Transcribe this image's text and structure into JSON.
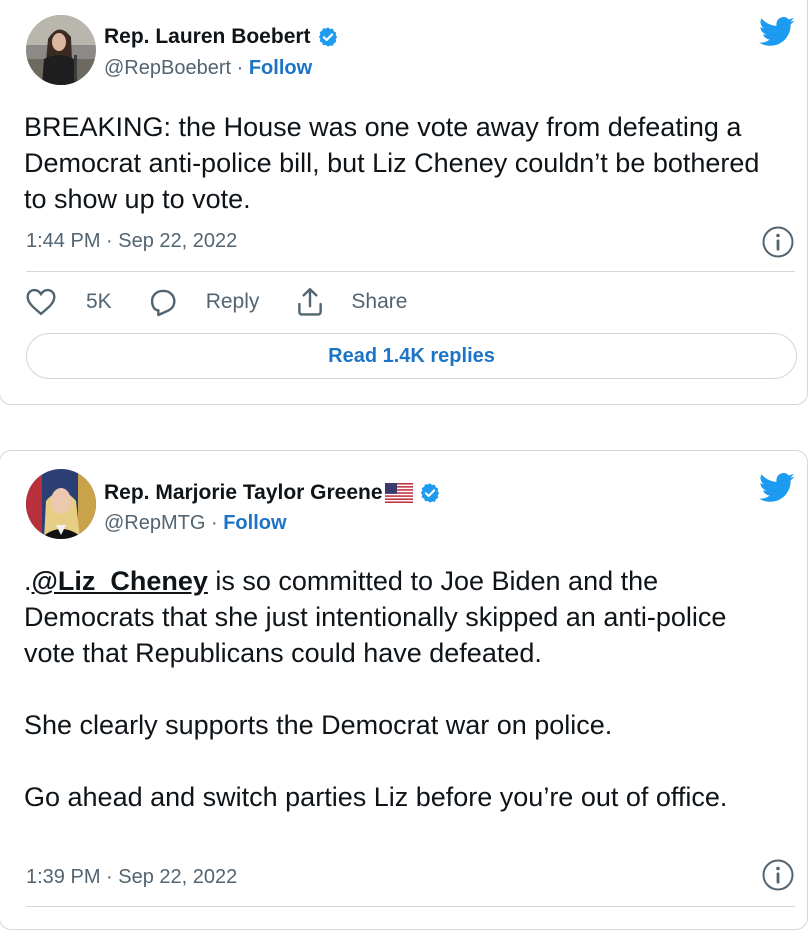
{
  "colors": {
    "link_blue": "#1d74c6",
    "twitter_blue": "#1d9bf0",
    "text_primary": "#0f1419",
    "text_secondary": "#536471",
    "border": "#cfd9de"
  },
  "tweets": [
    {
      "author_name": "Rep. Lauren Boebert",
      "handle": "@RepBoebert",
      "separator": " · ",
      "follow_label": "Follow",
      "text": "BREAKING: the House was one vote away from defeating a Democrat anti-police bill, but Liz Cheney couldn’t be bothered to show up to vote.",
      "timestamp": "1:44 PM · Sep 22, 2022",
      "like_count": "5K",
      "reply_label": "Reply",
      "share_label": "Share",
      "read_replies_label": "Read 1.4K replies",
      "icons": [
        "twitter-bird-icon",
        "verified-badge-icon",
        "info-icon",
        "heart-icon",
        "reply-icon",
        "share-icon"
      ]
    },
    {
      "author_name": "Rep. Marjorie Taylor Greene",
      "handle": "@RepMTG",
      "separator": " · ",
      "follow_label": "Follow",
      "text_prefix": ".",
      "mention": "@Liz_Cheney",
      "text_rest": " is so committed to Joe Biden and the Democrats that she just intentionally skipped an anti-police vote that Republicans could have defeated.\n\nShe clearly supports the Democrat war on police.\n\nGo ahead and switch parties Liz before you’re out of office.",
      "timestamp": "1:39 PM · Sep 22, 2022",
      "icons": [
        "twitter-bird-icon",
        "us-flag-icon",
        "verified-badge-icon",
        "info-icon"
      ]
    }
  ]
}
